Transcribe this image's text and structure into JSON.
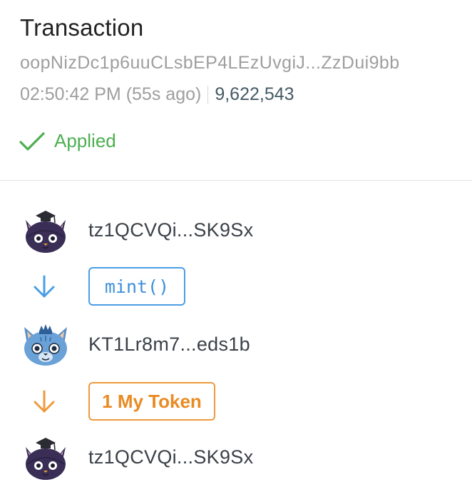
{
  "header": {
    "title": "Transaction",
    "hash": "oopNizDc1p6uuCLsbEP4LEzUvgiJ...ZzDui9bb",
    "time": "02:50:42 PM (55s ago)",
    "block": "9,622,543",
    "status": "Applied",
    "status_icon": "check-icon",
    "status_color": "#4caf50"
  },
  "flow": {
    "sender": {
      "address": "tz1QCVQi...SK9Sx",
      "avatar": "cat-graduation-cap-avatar"
    },
    "entrypoint": {
      "label": "mint()",
      "arrow_icon": "arrow-down-icon",
      "color": "#4a9ee6"
    },
    "contract": {
      "address": "KT1Lr8m7...eds1b",
      "avatar": "cat-crown-avatar"
    },
    "transfer": {
      "label": "1 My Token",
      "arrow_icon": "arrow-down-icon",
      "color": "#ee9a3d"
    },
    "receiver": {
      "address": "tz1QCVQi...SK9Sx",
      "avatar": "cat-graduation-cap-avatar"
    }
  }
}
